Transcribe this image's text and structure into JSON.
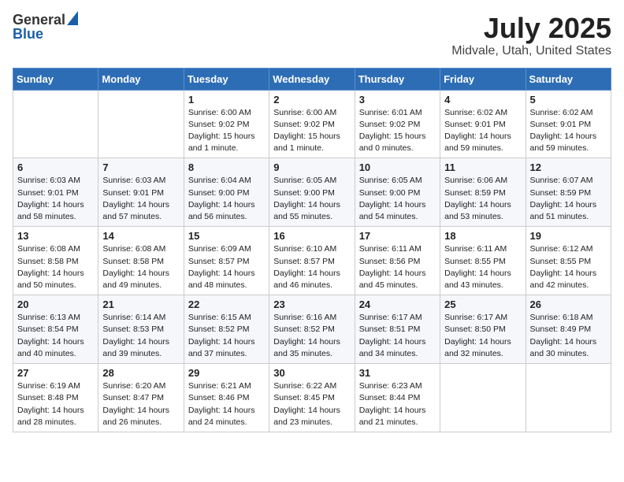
{
  "header": {
    "logo_general": "General",
    "logo_blue": "Blue",
    "title": "July 2025",
    "subtitle": "Midvale, Utah, United States"
  },
  "days_of_week": [
    "Sunday",
    "Monday",
    "Tuesday",
    "Wednesday",
    "Thursday",
    "Friday",
    "Saturday"
  ],
  "weeks": [
    [
      {
        "day": "",
        "info": ""
      },
      {
        "day": "",
        "info": ""
      },
      {
        "day": "1",
        "info": "Sunrise: 6:00 AM\nSunset: 9:02 PM\nDaylight: 15 hours and 1 minute."
      },
      {
        "day": "2",
        "info": "Sunrise: 6:00 AM\nSunset: 9:02 PM\nDaylight: 15 hours and 1 minute."
      },
      {
        "day": "3",
        "info": "Sunrise: 6:01 AM\nSunset: 9:02 PM\nDaylight: 15 hours and 0 minutes."
      },
      {
        "day": "4",
        "info": "Sunrise: 6:02 AM\nSunset: 9:01 PM\nDaylight: 14 hours and 59 minutes."
      },
      {
        "day": "5",
        "info": "Sunrise: 6:02 AM\nSunset: 9:01 PM\nDaylight: 14 hours and 59 minutes."
      }
    ],
    [
      {
        "day": "6",
        "info": "Sunrise: 6:03 AM\nSunset: 9:01 PM\nDaylight: 14 hours and 58 minutes."
      },
      {
        "day": "7",
        "info": "Sunrise: 6:03 AM\nSunset: 9:01 PM\nDaylight: 14 hours and 57 minutes."
      },
      {
        "day": "8",
        "info": "Sunrise: 6:04 AM\nSunset: 9:00 PM\nDaylight: 14 hours and 56 minutes."
      },
      {
        "day": "9",
        "info": "Sunrise: 6:05 AM\nSunset: 9:00 PM\nDaylight: 14 hours and 55 minutes."
      },
      {
        "day": "10",
        "info": "Sunrise: 6:05 AM\nSunset: 9:00 PM\nDaylight: 14 hours and 54 minutes."
      },
      {
        "day": "11",
        "info": "Sunrise: 6:06 AM\nSunset: 8:59 PM\nDaylight: 14 hours and 53 minutes."
      },
      {
        "day": "12",
        "info": "Sunrise: 6:07 AM\nSunset: 8:59 PM\nDaylight: 14 hours and 51 minutes."
      }
    ],
    [
      {
        "day": "13",
        "info": "Sunrise: 6:08 AM\nSunset: 8:58 PM\nDaylight: 14 hours and 50 minutes."
      },
      {
        "day": "14",
        "info": "Sunrise: 6:08 AM\nSunset: 8:58 PM\nDaylight: 14 hours and 49 minutes."
      },
      {
        "day": "15",
        "info": "Sunrise: 6:09 AM\nSunset: 8:57 PM\nDaylight: 14 hours and 48 minutes."
      },
      {
        "day": "16",
        "info": "Sunrise: 6:10 AM\nSunset: 8:57 PM\nDaylight: 14 hours and 46 minutes."
      },
      {
        "day": "17",
        "info": "Sunrise: 6:11 AM\nSunset: 8:56 PM\nDaylight: 14 hours and 45 minutes."
      },
      {
        "day": "18",
        "info": "Sunrise: 6:11 AM\nSunset: 8:55 PM\nDaylight: 14 hours and 43 minutes."
      },
      {
        "day": "19",
        "info": "Sunrise: 6:12 AM\nSunset: 8:55 PM\nDaylight: 14 hours and 42 minutes."
      }
    ],
    [
      {
        "day": "20",
        "info": "Sunrise: 6:13 AM\nSunset: 8:54 PM\nDaylight: 14 hours and 40 minutes."
      },
      {
        "day": "21",
        "info": "Sunrise: 6:14 AM\nSunset: 8:53 PM\nDaylight: 14 hours and 39 minutes."
      },
      {
        "day": "22",
        "info": "Sunrise: 6:15 AM\nSunset: 8:52 PM\nDaylight: 14 hours and 37 minutes."
      },
      {
        "day": "23",
        "info": "Sunrise: 6:16 AM\nSunset: 8:52 PM\nDaylight: 14 hours and 35 minutes."
      },
      {
        "day": "24",
        "info": "Sunrise: 6:17 AM\nSunset: 8:51 PM\nDaylight: 14 hours and 34 minutes."
      },
      {
        "day": "25",
        "info": "Sunrise: 6:17 AM\nSunset: 8:50 PM\nDaylight: 14 hours and 32 minutes."
      },
      {
        "day": "26",
        "info": "Sunrise: 6:18 AM\nSunset: 8:49 PM\nDaylight: 14 hours and 30 minutes."
      }
    ],
    [
      {
        "day": "27",
        "info": "Sunrise: 6:19 AM\nSunset: 8:48 PM\nDaylight: 14 hours and 28 minutes."
      },
      {
        "day": "28",
        "info": "Sunrise: 6:20 AM\nSunset: 8:47 PM\nDaylight: 14 hours and 26 minutes."
      },
      {
        "day": "29",
        "info": "Sunrise: 6:21 AM\nSunset: 8:46 PM\nDaylight: 14 hours and 24 minutes."
      },
      {
        "day": "30",
        "info": "Sunrise: 6:22 AM\nSunset: 8:45 PM\nDaylight: 14 hours and 23 minutes."
      },
      {
        "day": "31",
        "info": "Sunrise: 6:23 AM\nSunset: 8:44 PM\nDaylight: 14 hours and 21 minutes."
      },
      {
        "day": "",
        "info": ""
      },
      {
        "day": "",
        "info": ""
      }
    ]
  ]
}
